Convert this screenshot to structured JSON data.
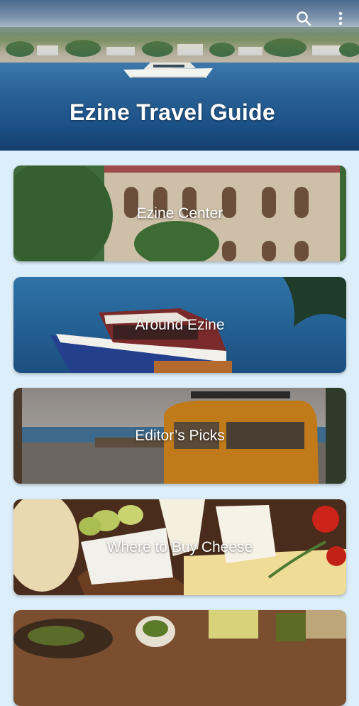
{
  "header": {
    "title": "Ezine Travel Guide",
    "search_icon": "search-icon",
    "menu_icon": "more-vert-icon"
  },
  "cards": [
    {
      "label": "Ezine Center"
    },
    {
      "label": "Around Ezine"
    },
    {
      "label": "Editor’s Picks"
    },
    {
      "label": "Where to Buy Cheese"
    },
    {
      "label": ""
    }
  ],
  "colors": {
    "background": "#dceef9",
    "header_text": "#ffffff",
    "card_text": "#ffffff"
  }
}
